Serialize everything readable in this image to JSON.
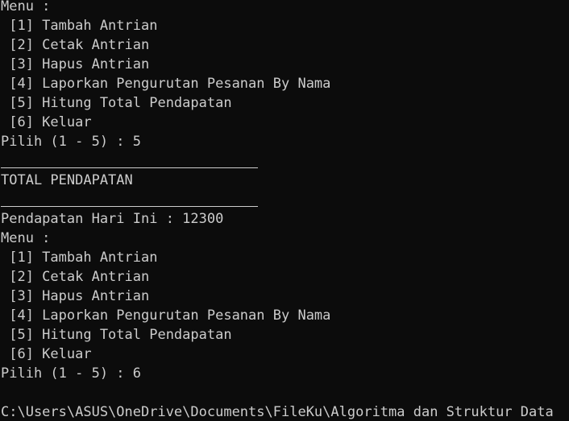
{
  "console": {
    "block1": {
      "menu_title": "Menu :",
      "items": [
        " [1] Tambah Antrian",
        " [2] Cetak Antrian",
        " [3] Hapus Antrian",
        " [4] Laporkan Pengurutan Pesanan By Nama",
        " [5] Hitung Total Pendapatan",
        " [6] Keluar"
      ],
      "prompt": "Pilih (1 - 5) : 5"
    },
    "report": {
      "heading": "TOTAL PENDAPATAN",
      "result": "Pendapatan Hari Ini : 12300"
    },
    "block2": {
      "menu_title": "Menu :",
      "items": [
        " [1] Tambah Antrian",
        " [2] Cetak Antrian",
        " [3] Hapus Antrian",
        " [4] Laporkan Pengurutan Pesanan By Nama",
        " [5] Hitung Total Pendapatan",
        " [6] Keluar"
      ],
      "prompt": "Pilih (1 - 5) : 6"
    },
    "shell_prompt": "C:\\Users\\ASUS\\OneDrive\\Documents\\FileKu\\Algoritma dan Struktur Data"
  }
}
